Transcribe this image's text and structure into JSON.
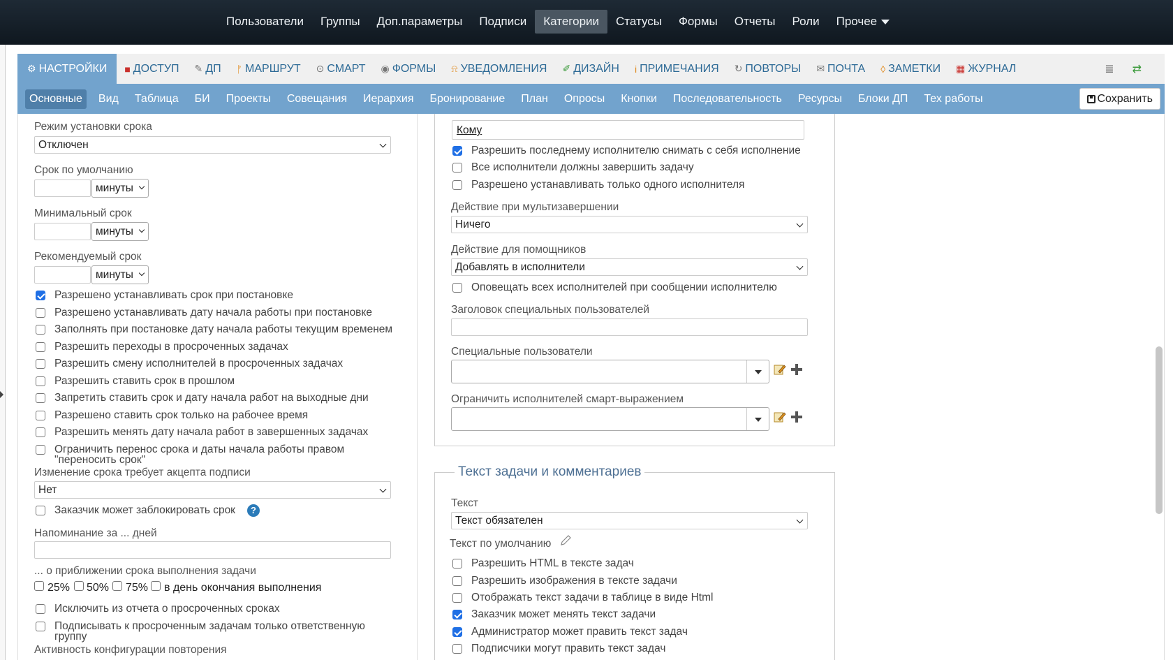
{
  "topnav": {
    "items": [
      {
        "label": "Пользователи"
      },
      {
        "label": "Группы"
      },
      {
        "label": "Доп.параметры"
      },
      {
        "label": "Подписи"
      },
      {
        "label": "Категории",
        "active": true
      },
      {
        "label": "Статусы"
      },
      {
        "label": "Формы"
      },
      {
        "label": "Отчеты"
      },
      {
        "label": "Роли"
      },
      {
        "label": "Прочее"
      }
    ]
  },
  "tabs": [
    {
      "label": "НАСТРОЙКИ",
      "icon": "gear-icon",
      "glyph": "⚙",
      "active": true
    },
    {
      "label": "ДОСТУП",
      "icon": "lock-icon",
      "glyph": "🔒"
    },
    {
      "label": "ДП",
      "icon": "edit-icon",
      "glyph": "✎"
    },
    {
      "label": "МАРШРУТ",
      "icon": "route-icon",
      "glyph": "⚑"
    },
    {
      "label": "СМАРТ",
      "icon": "play-circle-icon",
      "glyph": "▶"
    },
    {
      "label": "ФОРМЫ",
      "icon": "eye-icon",
      "glyph": "◉"
    },
    {
      "label": "УВЕДОМЛЕНИЯ",
      "icon": "bell-icon",
      "glyph": "🔔"
    },
    {
      "label": "ДИЗАЙН",
      "icon": "brush-icon",
      "glyph": "🖌"
    },
    {
      "label": "ПРИМЕЧАНИЯ",
      "icon": "info-icon",
      "glyph": "ℹ"
    },
    {
      "label": "ПОВТОРЫ",
      "icon": "refresh-icon",
      "glyph": "↻"
    },
    {
      "label": "ПОЧТА",
      "icon": "envelope-icon",
      "glyph": "✉"
    },
    {
      "label": "ЗАМЕТКИ",
      "icon": "bookmark-icon",
      "glyph": "🔖"
    },
    {
      "label": "ЖУРНАЛ",
      "icon": "calendar-icon",
      "glyph": "▦"
    }
  ],
  "subtabs": [
    {
      "label": "Основные",
      "active": true
    },
    {
      "label": "Вид"
    },
    {
      "label": "Таблица"
    },
    {
      "label": "БИ"
    },
    {
      "label": "Проекты"
    },
    {
      "label": "Совещания"
    },
    {
      "label": "Иерархия"
    },
    {
      "label": "Бронирование"
    },
    {
      "label": "План"
    },
    {
      "label": "Опросы"
    },
    {
      "label": "Кнопки"
    },
    {
      "label": "Последовательность"
    },
    {
      "label": "Ресурсы"
    },
    {
      "label": "Блоки ДП"
    },
    {
      "label": "Тех работы"
    }
  ],
  "save_label": "Сохранить",
  "left": {
    "deadline_mode_label": "Режим установки срока",
    "deadline_mode_value": "Отключен",
    "default_term_label": "Срок по умолчанию",
    "min_term_label": "Минимальный срок",
    "recommended_term_label": "Рекомендуемый срок",
    "unit_value": "минуты",
    "checkboxes": [
      {
        "label": "Разрешено устанавливать срок при постановке",
        "checked": true
      },
      {
        "label": "Разрешено устанавливать дату начала работы при постановке",
        "checked": false
      },
      {
        "label": "Заполнять при постановке дату начала работы текущим временем",
        "checked": false
      },
      {
        "label": "Разрешить переходы в просроченных задачах",
        "checked": false
      },
      {
        "label": "Разрешить смену исполнителей в просроченных задачах",
        "checked": false
      },
      {
        "label": "Разрешить ставить срок в прошлом",
        "checked": false
      },
      {
        "label": "Запретить ставить срок и дату начала работ на выходные дни",
        "checked": false
      },
      {
        "label": "Разрешено ставить срок только на рабочее время",
        "checked": false
      },
      {
        "label": "Разрешить менять дату начала работ в завершенных задачах",
        "checked": false
      }
    ],
    "limit_transfer_label_1": "Ограничить перенос срока и даты начала работы правом",
    "limit_transfer_label_2": "\"переносить срок\"",
    "change_requires_label": "Изменение срока требует акцепта подписи",
    "change_requires_value": "Нет",
    "customer_block_label": "Заказчик может заблокировать срок",
    "help_glyph": "?",
    "reminder_label": "Напоминание за ... дней",
    "approach_label": "... о приближении срока выполнения задачи",
    "percent_options": [
      {
        "label": "25%"
      },
      {
        "label": "50%"
      },
      {
        "label": "75%"
      },
      {
        "label": "в день окончания выполнения"
      }
    ],
    "exclude_report_label": "Исключить из отчета о просроченных сроках",
    "subscribe_overdue_label_1": "Подписывать к просроченным задачам только ответственную",
    "subscribe_overdue_label_2": "группу",
    "repeat_activity_label": "Активность конфигурации повторения"
  },
  "right": {
    "komu_label": "Кому",
    "checkboxes_top": [
      {
        "label": "Разрешить последнему исполнителю снимать с себя исполнение",
        "checked": true
      },
      {
        "label": "Все исполнители должны завершить задачу",
        "checked": false
      },
      {
        "label": "Разрешено устанавливать только одного исполнителя",
        "checked": false
      }
    ],
    "multi_action_label": "Действие при мультизавершении",
    "multi_action_value": "Ничего",
    "helpers_action_label": "Действие для помощников",
    "helpers_action_value": "Добавлять в исполнители",
    "notify_all_label": "Оповещать всех исполнителей при сообщении исполнителю",
    "special_header_label": "Заголовок специальных пользователей",
    "special_users_label": "Специальные пользователи",
    "limit_smart_label": "Ограничить исполнителей смарт-выражением",
    "section_title": "Текст задачи и комментариев",
    "text_label": "Текст",
    "text_value": "Текст обязателен",
    "default_text_label": "Текст по умолчанию",
    "checkboxes_bottom": [
      {
        "label": "Разрешить HTML в тексте задач",
        "checked": false
      },
      {
        "label": "Разрешить изображения в тексте задачи",
        "checked": false
      },
      {
        "label": "Отображать текст задачи в таблице в виде Html",
        "checked": false
      },
      {
        "label": "Заказчик может менять текст задачи",
        "checked": true
      },
      {
        "label": "Администратор может править текст задач",
        "checked": true
      },
      {
        "label": "Подписчики могут править текст задач",
        "checked": false
      }
    ]
  }
}
